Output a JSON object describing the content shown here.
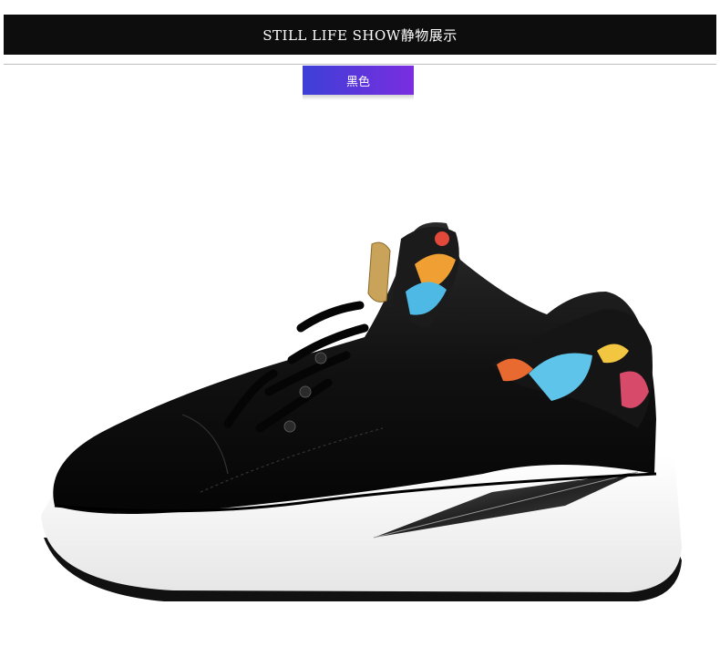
{
  "banner": {
    "title": "STILL LIFE SHOW静物展示"
  },
  "color_tab": {
    "label": "黑色"
  },
  "colors": {
    "banner": "#0d0d0d",
    "badge_start": "#3d3fd6",
    "badge_end": "#7a2ee0"
  }
}
